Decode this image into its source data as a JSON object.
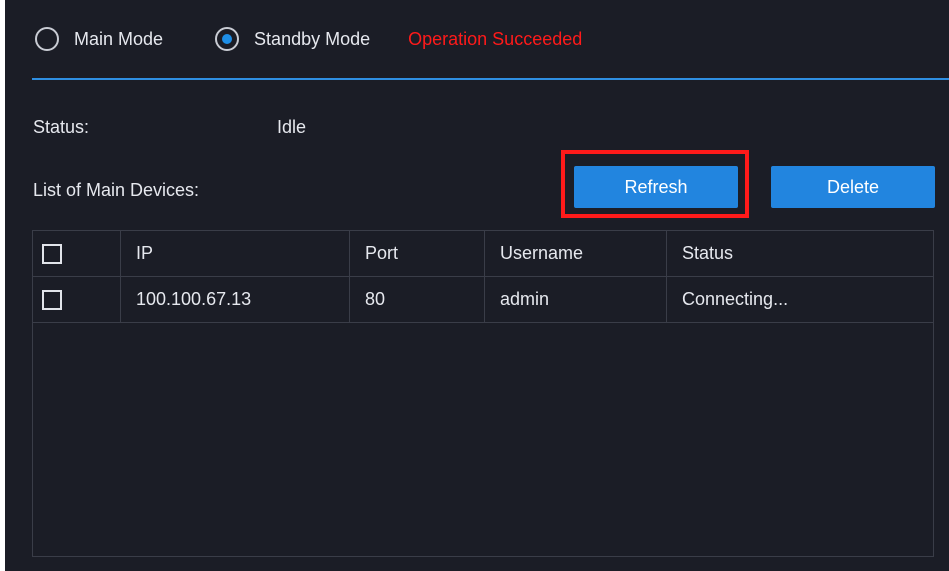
{
  "mode": {
    "main_label": "Main Mode",
    "standby_label": "Standby Mode",
    "selected": "standby",
    "operation_message": "Operation Succeeded"
  },
  "status": {
    "label": "Status:",
    "value": "Idle"
  },
  "devices": {
    "list_label": "List of Main Devices:",
    "refresh_label": "Refresh",
    "delete_label": "Delete",
    "columns": [
      "IP",
      "Port",
      "Username",
      "Status"
    ],
    "rows": [
      {
        "ip": "100.100.67.13",
        "port": "80",
        "username": "admin",
        "status": "Connecting..."
      }
    ]
  },
  "colors": {
    "background": "#1b1d26",
    "accent": "#2285df",
    "error": "#ff1a1a"
  }
}
